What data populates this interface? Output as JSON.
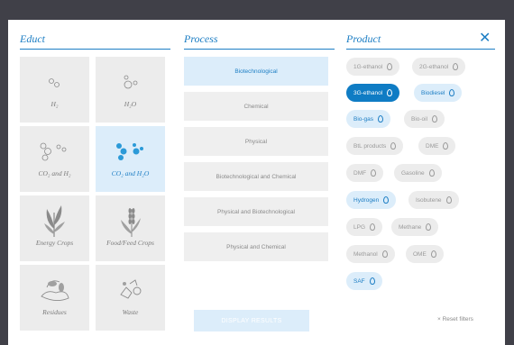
{
  "columns": {
    "educt": "Educt",
    "process": "Process",
    "product": "Product"
  },
  "close_icon": "close-icon",
  "educts": [
    {
      "label": "H₂",
      "icon": "h2-molecule-icon",
      "selected": false
    },
    {
      "label": "H₂O",
      "icon": "h2o-molecule-icon",
      "selected": false
    },
    {
      "label": "CO₂ and H₂",
      "icon": "co2-h2-molecule-icon",
      "selected": false
    },
    {
      "label": "CO₂ and H₂O",
      "icon": "co2-h2o-molecule-icon",
      "selected": true
    },
    {
      "label": "Energy Crops",
      "icon": "energy-crops-icon",
      "selected": false
    },
    {
      "label": "Food/Feed Crops",
      "icon": "food-feed-crops-icon",
      "selected": false
    },
    {
      "label": "Residues",
      "icon": "residues-icon",
      "selected": false
    },
    {
      "label": "Waste",
      "icon": "waste-icon",
      "selected": false
    }
  ],
  "processes": [
    {
      "label": "Biotechnological",
      "selected": true
    },
    {
      "label": "Chemical",
      "selected": false
    },
    {
      "label": "Physical",
      "selected": false
    },
    {
      "label": "Biotechnological and Chemical",
      "selected": false
    },
    {
      "label": "Physical and Biotechnological",
      "selected": false
    },
    {
      "label": "Physical and Chemical",
      "selected": false
    }
  ],
  "products": [
    {
      "label": "1G-ethanol",
      "state": "default"
    },
    {
      "label": "2G-ethanol",
      "state": "default"
    },
    {
      "label": "3G-ethanol",
      "state": "active"
    },
    {
      "label": "Biodiesel",
      "state": "blue"
    },
    {
      "label": "Bio-gas",
      "state": "blue"
    },
    {
      "label": "Bio-oil",
      "state": "default"
    },
    {
      "label": "BtL products",
      "state": "default"
    },
    {
      "label": "DME",
      "state": "default"
    },
    {
      "label": "DMF",
      "state": "default"
    },
    {
      "label": "Gasoline",
      "state": "default"
    },
    {
      "label": "Hydrogen",
      "state": "blue"
    },
    {
      "label": "Isobutene",
      "state": "default"
    },
    {
      "label": "LPG",
      "state": "default"
    },
    {
      "label": "Methane",
      "state": "default"
    },
    {
      "label": "Methanol",
      "state": "default"
    },
    {
      "label": "OME",
      "state": "default"
    },
    {
      "label": "SAF",
      "state": "blue"
    }
  ],
  "actions": {
    "display_results": "DISPLAY RESULTS",
    "reset_filters": "× Reset filters"
  },
  "colors": {
    "accent": "#1d7ec4",
    "active_pill": "#0f7cc4",
    "selected_bg": "#dcedfa",
    "tile_bg": "#ececec",
    "frame": "#404048"
  }
}
